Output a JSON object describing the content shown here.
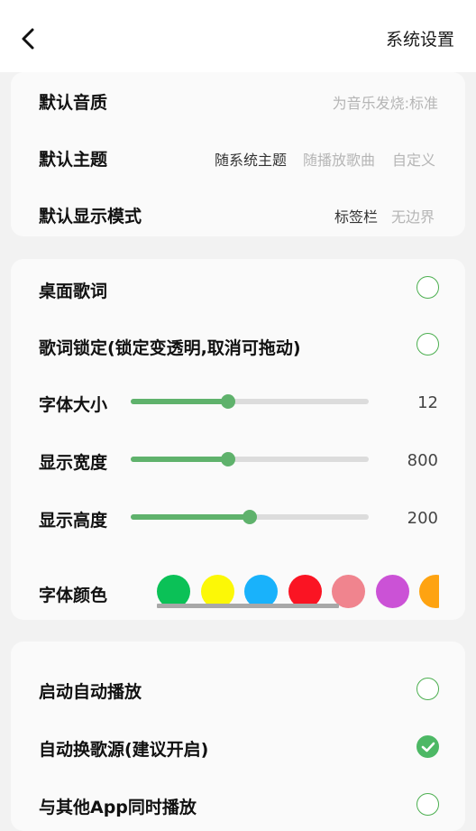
{
  "header": {
    "title": "系统设置",
    "back_icon": "chevron-left-icon"
  },
  "card_quality_theme": {
    "quality": {
      "label": "默认音质",
      "value": "为音乐发烧:标准"
    },
    "theme": {
      "label": "默认主题",
      "options": [
        "随系统主题",
        "随播放歌曲",
        "自定义"
      ],
      "selected": "随系统主题"
    },
    "display_mode": {
      "label": "默认显示模式",
      "options": [
        "标签栏",
        "无边界"
      ],
      "selected": "标签栏"
    }
  },
  "card_lyrics": {
    "desktop_lyrics": {
      "label": "桌面歌词",
      "checked": false
    },
    "lyrics_lock": {
      "label": "歌词锁定(锁定变透明,取消可拖动)",
      "checked": false
    },
    "font_size": {
      "label": "字体大小",
      "value": "12",
      "fill": 0.41
    },
    "display_width": {
      "label": "显示宽度",
      "value": "800",
      "fill": 0.41
    },
    "display_height": {
      "label": "显示高度",
      "value": "200",
      "fill": 0.5
    },
    "font_color": {
      "label": "字体颜色",
      "colors": [
        "#0bc157",
        "#fcf806",
        "#19b2fb",
        "#fa1423",
        "#f0848e",
        "#cb52d6",
        "#fea311"
      ],
      "scroll_fraction": 0.65
    }
  },
  "card_playback": {
    "auto_play": {
      "label": "启动自动播放",
      "checked": false
    },
    "auto_source": {
      "label": "自动换歌源(建议开启)",
      "checked": true
    },
    "mix_play": {
      "label": "与其他App同时播放",
      "checked": false
    }
  },
  "colors": {
    "accent": "#5fb26c",
    "check": "#4db865"
  }
}
